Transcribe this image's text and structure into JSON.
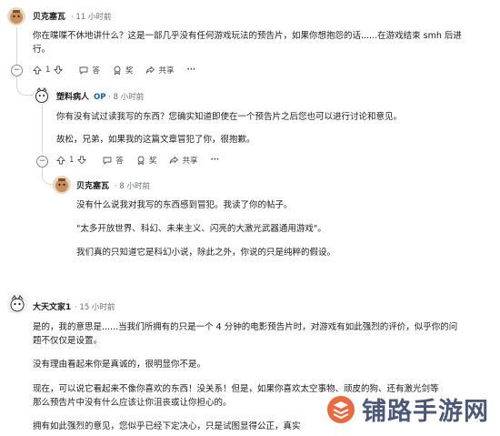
{
  "comments": [
    {
      "user": "贝克塞瓦",
      "time": "11 小时前",
      "text": [
        "你在喋喋不休地讲什么？这是一部几乎没有任何游戏玩法的预告片，如果你想抱怨的话......在游戏结束 smh 后进",
        "行。"
      ],
      "votes": "1",
      "reply": "答",
      "award": "奖",
      "share": "共享",
      "more": "···"
    },
    {
      "user": "塑料病人",
      "op": "OP",
      "time": "8 小时前",
      "text": [
        "你有没有试过读我写的东西？您确实知道即使在一个预告片之后您也可以进行讨论和意见。"
      ],
      "text2": "故松，兄弟，如果我的这篇文章冒犯了你，很抱歉。",
      "votes": "1",
      "reply": "答",
      "award": "奖",
      "share": "共享",
      "more": "···"
    },
    {
      "user": "贝克塞瓦",
      "time": "8 小时前",
      "p1": "没有什么说我对我写的东西感到冒犯。我读了你的帖子。",
      "p2": "\"太多开放世界、科幻、未来主义、闪亮的大激光武器通用游戏\"。",
      "p3": "我们真的只知道它是科幻小说，除此之外，你说的只是纯粹的假设。"
    },
    {
      "user": "大天文家1",
      "time": "15 小时前",
      "p1": [
        "是的，我的意思是......当我们所拥有的只是一个 4 分钟的电影预告片时，对游戏有如此强烈的评价，似乎你的问",
        "题不仅仅是设置。"
      ],
      "p2": "没有理由看起来你是真诚的，很明显你不是。",
      "p3": [
        "现在，可以说它看起来不像你喜欢的东西！没关系！但是，如果你喜欢太空事物、顽皮的狗、还有激光剑等",
        "那么预告片中没有什么应该让你沮丧或让你担心的。"
      ],
      "p4": "拥有如此强烈的意见，您似乎已经下定决心，只是试图显得公正，真实"
    }
  ],
  "watermark": {
    "text": "铺路手游网"
  }
}
